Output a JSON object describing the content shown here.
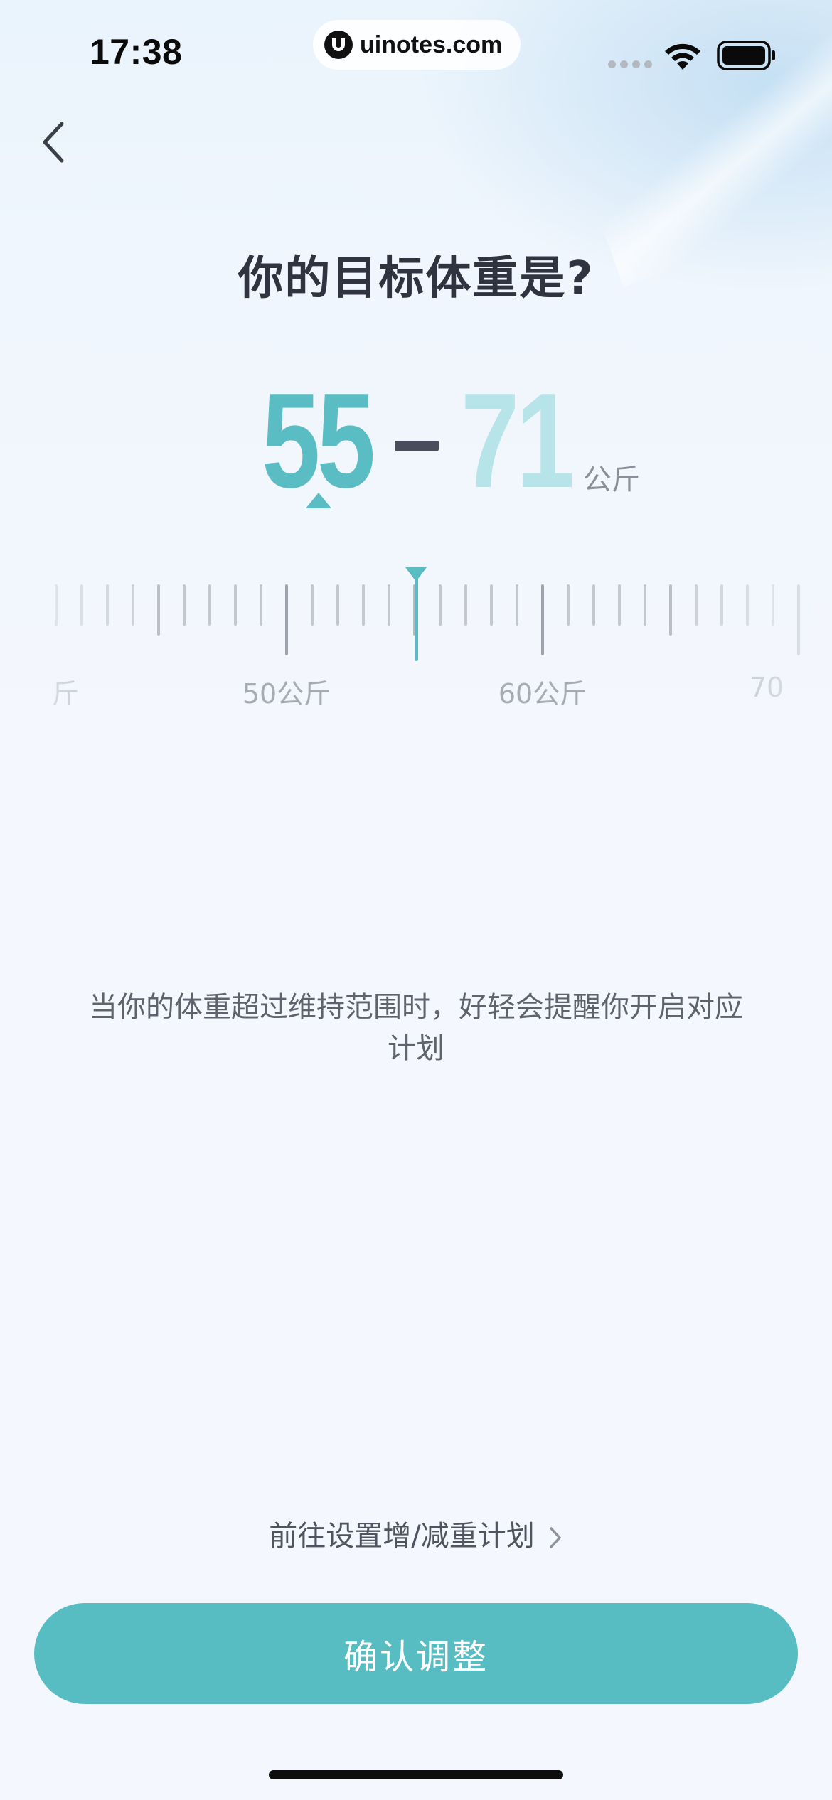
{
  "status_bar": {
    "time": "17:38",
    "url": "uinotes.com",
    "icons": [
      "signal-icon",
      "wifi-icon",
      "battery-icon"
    ]
  },
  "nav": {
    "back_icon": "chevron-left-icon"
  },
  "title": "你的目标体重是?",
  "range": {
    "min": "55",
    "max": "71",
    "unit": "公斤"
  },
  "ruler": {
    "labels": [
      "斤",
      "50公斤",
      "60公斤",
      "70"
    ],
    "selected_value": 55
  },
  "hint": "当你的体重超过维持范围时，好轻会提醒你开启对应计划",
  "plan_link": {
    "label": "前往设置增/减重计划",
    "icon": "chevron-right-icon"
  },
  "confirm_button": {
    "label": "确认调整"
  },
  "colors": {
    "accent": "#58bcc3",
    "accent_light": "#b7e4e8",
    "text_dark": "#2f3440"
  }
}
